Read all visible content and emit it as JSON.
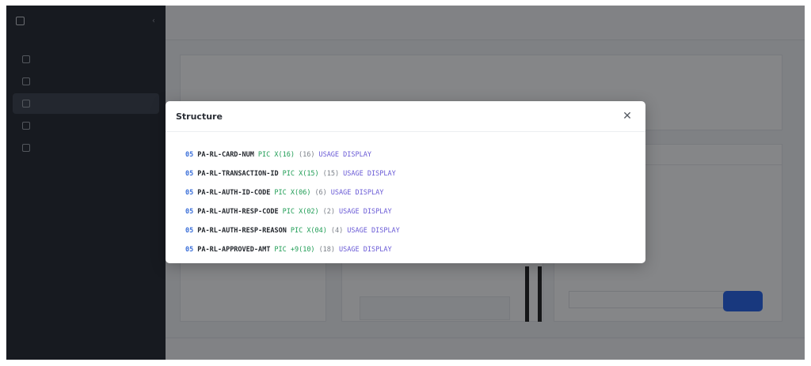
{
  "modal": {
    "title": "Structure",
    "close_icon": "close-icon",
    "fields": [
      {
        "level": "05",
        "name": "PA-RL-CARD-NUM",
        "pic": "PIC X(16)",
        "length": "(16)",
        "usage": "USAGE DISPLAY"
      },
      {
        "level": "05",
        "name": "PA-RL-TRANSACTION-ID",
        "pic": "PIC X(15)",
        "length": "(15)",
        "usage": "USAGE DISPLAY"
      },
      {
        "level": "05",
        "name": "PA-RL-AUTH-ID-CODE",
        "pic": "PIC X(06)",
        "length": "(6)",
        "usage": "USAGE DISPLAY"
      },
      {
        "level": "05",
        "name": "PA-RL-AUTH-RESP-CODE",
        "pic": "PIC X(02)",
        "length": "(2)",
        "usage": "USAGE DISPLAY"
      },
      {
        "level": "05",
        "name": "PA-RL-AUTH-RESP-REASON",
        "pic": "PIC X(04)",
        "length": "(4)",
        "usage": "USAGE DISPLAY"
      },
      {
        "level": "05",
        "name": "PA-RL-APPROVED-AMT",
        "pic": "PIC +9(10)",
        "length": "(18)",
        "usage": "USAGE DISPLAY"
      }
    ]
  },
  "colors": {
    "level": "#3b6fd9",
    "pic": "#1f9d55",
    "usage": "#6a5bd6",
    "overlay": "rgba(12,14,18,0.5)"
  }
}
